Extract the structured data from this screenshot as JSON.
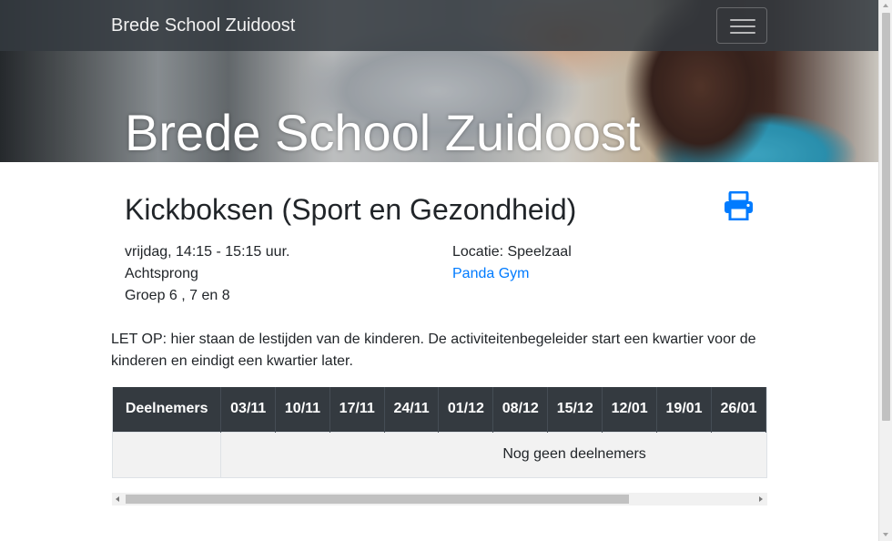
{
  "navbar": {
    "brand": "Brede School Zuidoost",
    "toggler_icon": "hamburger-icon"
  },
  "hero": {
    "title": "Brede School Zuidoost"
  },
  "activity": {
    "title": "Kickboksen (Sport en Gezondheid)",
    "print_icon": "print-icon",
    "schedule": "vrijdag, 14:15 - 15:15 uur.",
    "school": "Achtsprong",
    "groups": "Groep 6 , 7 en 8",
    "location": "Locatie: Speelzaal",
    "provider_link": "Panda Gym"
  },
  "note": "LET OP: hier staan de lestijden van de kinderen. De activiteitenbegeleider start een kwartier voor de kinderen en eindigt een kwartier later.",
  "table": {
    "header_first": "Deelnemers",
    "dates": [
      "03/11",
      "10/11",
      "17/11",
      "24/11",
      "01/12",
      "08/12",
      "15/12",
      "12/01",
      "19/01",
      "26/01"
    ],
    "empty_message": "Nog geen deelnemers"
  },
  "colors": {
    "link": "#007bff",
    "table_header_bg": "#343a40",
    "navbar_bg": "#343a40"
  }
}
